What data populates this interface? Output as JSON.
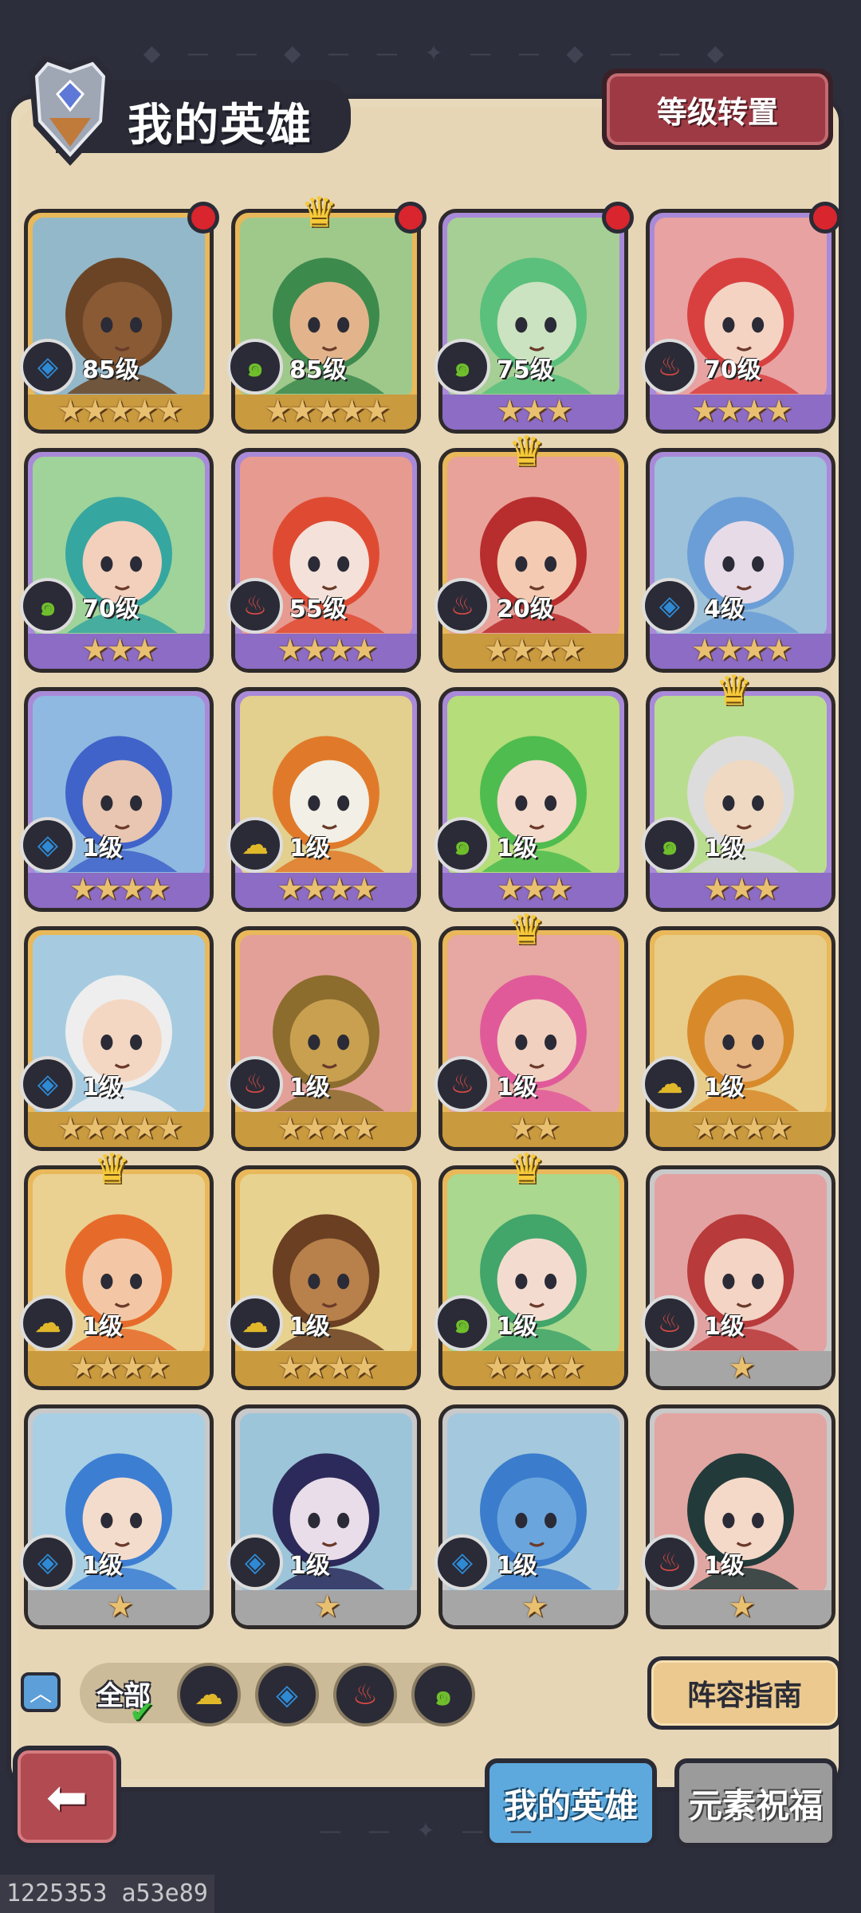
{
  "header": {
    "title": "我的英雄",
    "reset_label": "等级转置"
  },
  "colors": {
    "water": "#2f8ad6",
    "wind": "#6fbe2c",
    "fire": "#d94a45",
    "earth": "#e0b82a",
    "frame_gold": "#e8b85a",
    "frame_purple": "#a98ad8",
    "frame_silver": "#c9c9c9"
  },
  "element_glyphs": {
    "water": "◈",
    "wind": "๑",
    "fire": "♨",
    "earth": "☁"
  },
  "heroes": [
    {
      "level": "85级",
      "element": "water",
      "stars": "★★★★★",
      "frame": "gold",
      "bg": "#93b8c9",
      "skin": "#8a5a34",
      "hair": "#6b4426",
      "new": true,
      "crown": false
    },
    {
      "level": "85级",
      "element": "wind",
      "stars": "★★★★★",
      "frame": "gold",
      "bg": "#9fc98b",
      "skin": "#e3b48b",
      "hair": "#3d8a4d",
      "new": true,
      "crown": true
    },
    {
      "level": "75级",
      "element": "wind",
      "stars": "★★★",
      "frame": "purple",
      "bg": "#a5cf95",
      "skin": "#cbe3c0",
      "hair": "#5ac07c",
      "new": true,
      "crown": false
    },
    {
      "level": "70级",
      "element": "fire",
      "stars": "★★★★",
      "frame": "purple",
      "bg": "#e8a2a2",
      "skin": "#f5d3c3",
      "hair": "#d84040",
      "new": true,
      "crown": false
    },
    {
      "level": "70级",
      "element": "wind",
      "stars": "★★★",
      "frame": "purple",
      "bg": "#9fd39a",
      "skin": "#f2d0bc",
      "hair": "#36a6a0",
      "new": false,
      "crown": false
    },
    {
      "level": "55级",
      "element": "fire",
      "stars": "★★★★",
      "frame": "purple",
      "bg": "#e79a90",
      "skin": "#f4e2da",
      "hair": "#df4b32",
      "new": false,
      "crown": false
    },
    {
      "level": "20级",
      "element": "fire",
      "stars": "★★★★",
      "frame": "gold",
      "bg": "#e8a29a",
      "skin": "#f4cbb2",
      "hair": "#b82d2d",
      "new": false,
      "crown": true
    },
    {
      "level": "4级",
      "element": "water",
      "stars": "★★★★",
      "frame": "purple",
      "bg": "#9cc1d9",
      "skin": "#e8dbe8",
      "hair": "#6b9ed6",
      "new": false,
      "crown": false
    },
    {
      "level": "1级",
      "element": "water",
      "stars": "★★★★",
      "frame": "purple",
      "bg": "#8fb9e0",
      "skin": "#e8c6b1",
      "hair": "#3f63c9",
      "new": false,
      "crown": false
    },
    {
      "level": "1级",
      "element": "earth",
      "stars": "★★★★",
      "frame": "purple",
      "bg": "#e3cf8e",
      "skin": "#f2efe6",
      "hair": "#e07a2a",
      "new": false,
      "crown": false
    },
    {
      "level": "1级",
      "element": "wind",
      "stars": "★★★",
      "frame": "purple",
      "bg": "#b5dd7a",
      "skin": "#f4dacb",
      "hair": "#4fbc4f",
      "new": false,
      "crown": false
    },
    {
      "level": "1级",
      "element": "wind",
      "stars": "★★★",
      "frame": "purple",
      "bg": "#b9dd8e",
      "skin": "#efd9c2",
      "hair": "#dcdcdc",
      "new": false,
      "crown": true
    },
    {
      "level": "1级",
      "element": "water",
      "stars": "★★★★★",
      "frame": "gold",
      "bg": "#a6cbe0",
      "skin": "#f3d7c3",
      "hair": "#eeeeee",
      "new": false,
      "crown": false
    },
    {
      "level": "1级",
      "element": "fire",
      "stars": "★★★★",
      "frame": "gold",
      "bg": "#e3a098",
      "skin": "#c8a050",
      "hair": "#8c6d2d",
      "new": false,
      "crown": false
    },
    {
      "level": "1级",
      "element": "fire",
      "stars": "★★",
      "frame": "gold",
      "bg": "#e7a7a2",
      "skin": "#f2d0c0",
      "hair": "#e05a9a",
      "new": false,
      "crown": true
    },
    {
      "level": "1级",
      "element": "earth",
      "stars": "★★★★",
      "frame": "gold",
      "bg": "#e8cd8a",
      "skin": "#e8b985",
      "hair": "#d88a2a",
      "new": false,
      "crown": false
    },
    {
      "level": "1级",
      "element": "earth",
      "stars": "★★★★",
      "frame": "gold",
      "bg": "#ead192",
      "skin": "#f3c7a5",
      "hair": "#e66b2a",
      "new": false,
      "crown": true
    },
    {
      "level": "1级",
      "element": "earth",
      "stars": "★★★★",
      "frame": "gold",
      "bg": "#e8d290",
      "skin": "#b8804a",
      "hair": "#6a3f22",
      "new": false,
      "crown": false
    },
    {
      "level": "1级",
      "element": "wind",
      "stars": "★★★★",
      "frame": "gold",
      "bg": "#aad88e",
      "skin": "#f3dccf",
      "hair": "#42a56a",
      "new": false,
      "crown": true
    },
    {
      "level": "1级",
      "element": "fire",
      "stars": "★",
      "frame": "silver",
      "bg": "#e3a2a2",
      "skin": "#f4d4c4",
      "hair": "#b83a3a",
      "new": false,
      "crown": false
    },
    {
      "level": "1级",
      "element": "water",
      "stars": "★",
      "frame": "silver",
      "bg": "#a8cfe4",
      "skin": "#f4dccd",
      "hair": "#3c7ed2",
      "new": false,
      "crown": false
    },
    {
      "level": "1级",
      "element": "water",
      "stars": "★",
      "frame": "silver",
      "bg": "#9dc5da",
      "skin": "#e9dde9",
      "hair": "#2c2a5a",
      "new": false,
      "crown": false
    },
    {
      "level": "1级",
      "element": "water",
      "stars": "★",
      "frame": "silver",
      "bg": "#a4c8dd",
      "skin": "#6aa6dd",
      "hair": "#3b7ccc",
      "new": false,
      "crown": false
    },
    {
      "level": "1级",
      "element": "fire",
      "stars": "★",
      "frame": "silver",
      "bg": "#e2a6a2",
      "skin": "#f4d9c9",
      "hair": "#223a3a",
      "new": false,
      "crown": false
    }
  ],
  "filters": {
    "all_label": "全部",
    "elements": [
      "earth",
      "water",
      "fire",
      "wind"
    ]
  },
  "guide_label": "阵容指南",
  "tabs": {
    "mine": "我的英雄",
    "elements": "元素祝福"
  },
  "footer_id": "1225353 a53e89"
}
